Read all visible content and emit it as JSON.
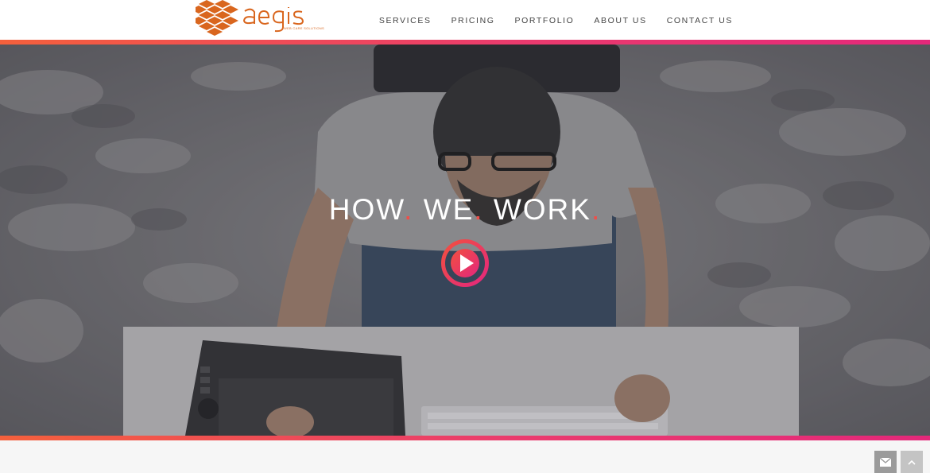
{
  "header": {
    "logo": {
      "name": "aegis",
      "tagline": "WEB CARE SOLUTIONS"
    },
    "nav": [
      {
        "label": "SERVICES"
      },
      {
        "label": "PRICING"
      },
      {
        "label": "PORTFOLIO"
      },
      {
        "label": "ABOUT US"
      },
      {
        "label": "CONTACT US"
      }
    ]
  },
  "hero": {
    "title_parts": [
      "HOW",
      "WE",
      "WORK"
    ],
    "title_dot": "."
  },
  "icons": {
    "play": "play-icon",
    "mail": "envelope-icon",
    "back_to_top": "chevron-up-icon"
  },
  "colors": {
    "accent_orange": "#f4603c",
    "accent_pink": "#e4287a",
    "logo_orange": "#d9661e",
    "nav_text": "#444444"
  }
}
